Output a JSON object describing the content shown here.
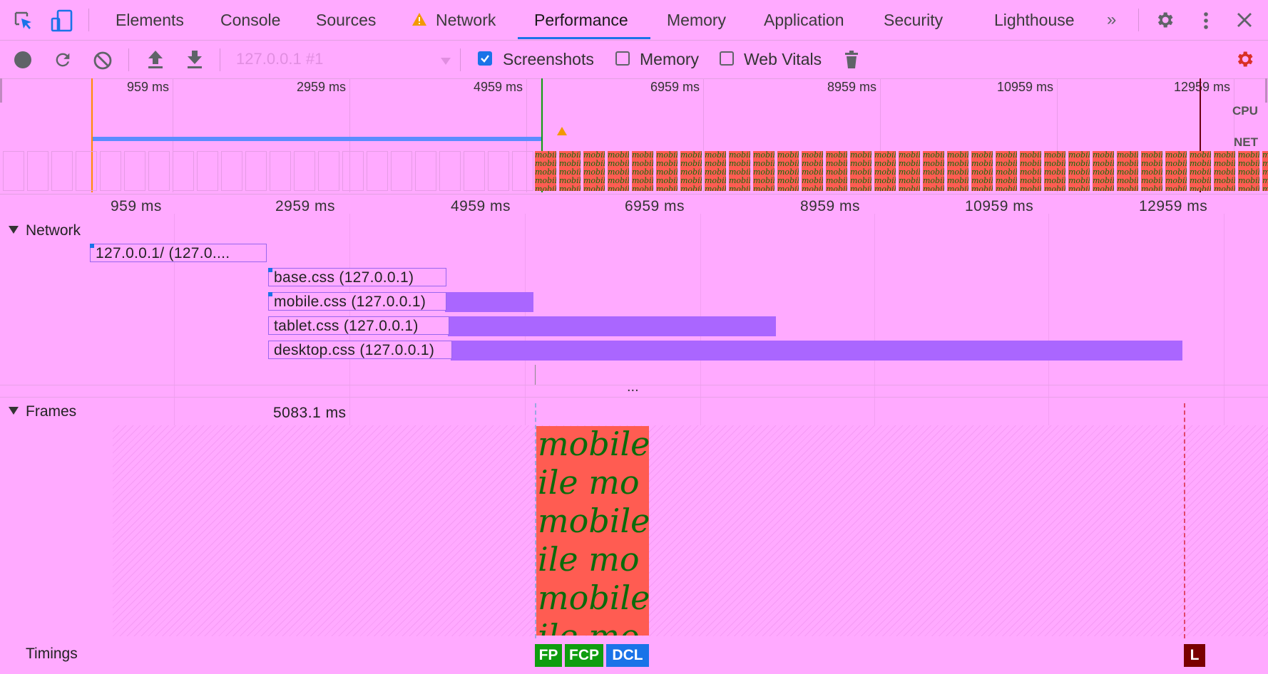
{
  "tabs": [
    {
      "label": "Elements"
    },
    {
      "label": "Console"
    },
    {
      "label": "Sources"
    },
    {
      "label": "Network",
      "warning": true
    },
    {
      "label": "Performance",
      "active": true
    },
    {
      "label": "Memory"
    },
    {
      "label": "Application"
    },
    {
      "label": "Security"
    },
    {
      "label": "Lighthouse"
    }
  ],
  "toolbar": {
    "profile_select": "127.0.0.1 #1",
    "checkboxes": [
      {
        "label": "Screenshots",
        "checked": true
      },
      {
        "label": "Memory",
        "checked": false
      },
      {
        "label": "Web Vitals",
        "checked": false
      }
    ]
  },
  "overview": {
    "ticks": [
      "959 ms",
      "2959 ms",
      "4959 ms",
      "6959 ms",
      "8959 ms",
      "10959 ms",
      "12959 ms"
    ],
    "cpu_label": "CPU",
    "net_label": "NET",
    "filmstrip_text": "mobile"
  },
  "main_ruler": {
    "ticks": [
      "959 ms",
      "2959 ms",
      "4959 ms",
      "6959 ms",
      "8959 ms",
      "10959 ms",
      "12959 ms"
    ]
  },
  "network": {
    "title": "Network",
    "requests": [
      {
        "label": "127.0.0.1/ (127.0...."
      },
      {
        "label": "base.css (127.0.0.1)"
      },
      {
        "label": "mobile.css (127.0.0.1)"
      },
      {
        "label": "tablet.css (127.0.0.1)"
      },
      {
        "label": "desktop.css (127.0.0.1)"
      }
    ],
    "more": "..."
  },
  "frames": {
    "title": "Frames",
    "duration": "5083.1 ms",
    "screenshot_text": "mobile",
    "screenshot_text_alt": "ile mo"
  },
  "timings": {
    "title": "Timings",
    "markers": [
      {
        "label": "FP",
        "color": "#0f9d0f"
      },
      {
        "label": "FCP",
        "color": "#0f9d0f"
      },
      {
        "label": "DCL",
        "color": "#1a73e8"
      },
      {
        "label": "L",
        "color": "#7a0000"
      }
    ]
  },
  "colors": {
    "background": "#ffaaff",
    "accent": "#1a73e8",
    "request_bar": "#aa66ff",
    "screenshot_bg": "#ff5c52",
    "screenshot_text": "#0b6b0b"
  }
}
